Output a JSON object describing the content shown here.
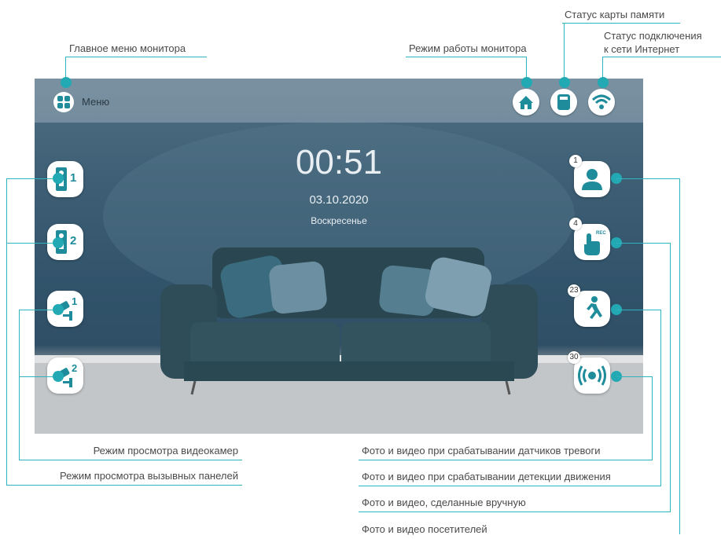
{
  "top_labels": {
    "main_menu": "Главное меню монитора",
    "monitor_mode": "Режим работы монитора",
    "memory_card_status": "Статус карты памяти",
    "internet_status_line1": "Статус подключения",
    "internet_status_line2": "к сети Интернет"
  },
  "screen": {
    "menu_label": "Меню",
    "time": "00:51",
    "date": "03.10.2020",
    "weekday": "Воскресенье"
  },
  "left_buttons": [
    {
      "number": "1",
      "icon": "call-panel-icon"
    },
    {
      "number": "2",
      "icon": "call-panel-icon"
    },
    {
      "number": "1",
      "icon": "cctv-camera-icon"
    },
    {
      "number": "2",
      "icon": "cctv-camera-icon"
    }
  ],
  "right_buttons": [
    {
      "count": "1",
      "icon": "visitor-person-icon"
    },
    {
      "count": "4",
      "icon": "manual-rec-hand-icon",
      "tag": "REC"
    },
    {
      "count": "23",
      "icon": "running-man-icon"
    },
    {
      "count": "30",
      "icon": "alarm-signal-icon"
    }
  ],
  "bottom_labels": {
    "camera_view_mode": "Режим просмотра видеокамер",
    "panel_view_mode": "Режим просмотра вызывных панелей",
    "alarm_media": "Фото и видео при срабатывании датчиков тревоги",
    "motion_media": "Фото и видео при срабатывании детекции движения",
    "manual_media": "Фото и видео, сделанные вручную",
    "visitor_media": "Фото и видео посетителей"
  },
  "colors": {
    "accent": "#22a9b3",
    "line": "#2fb3bd"
  }
}
